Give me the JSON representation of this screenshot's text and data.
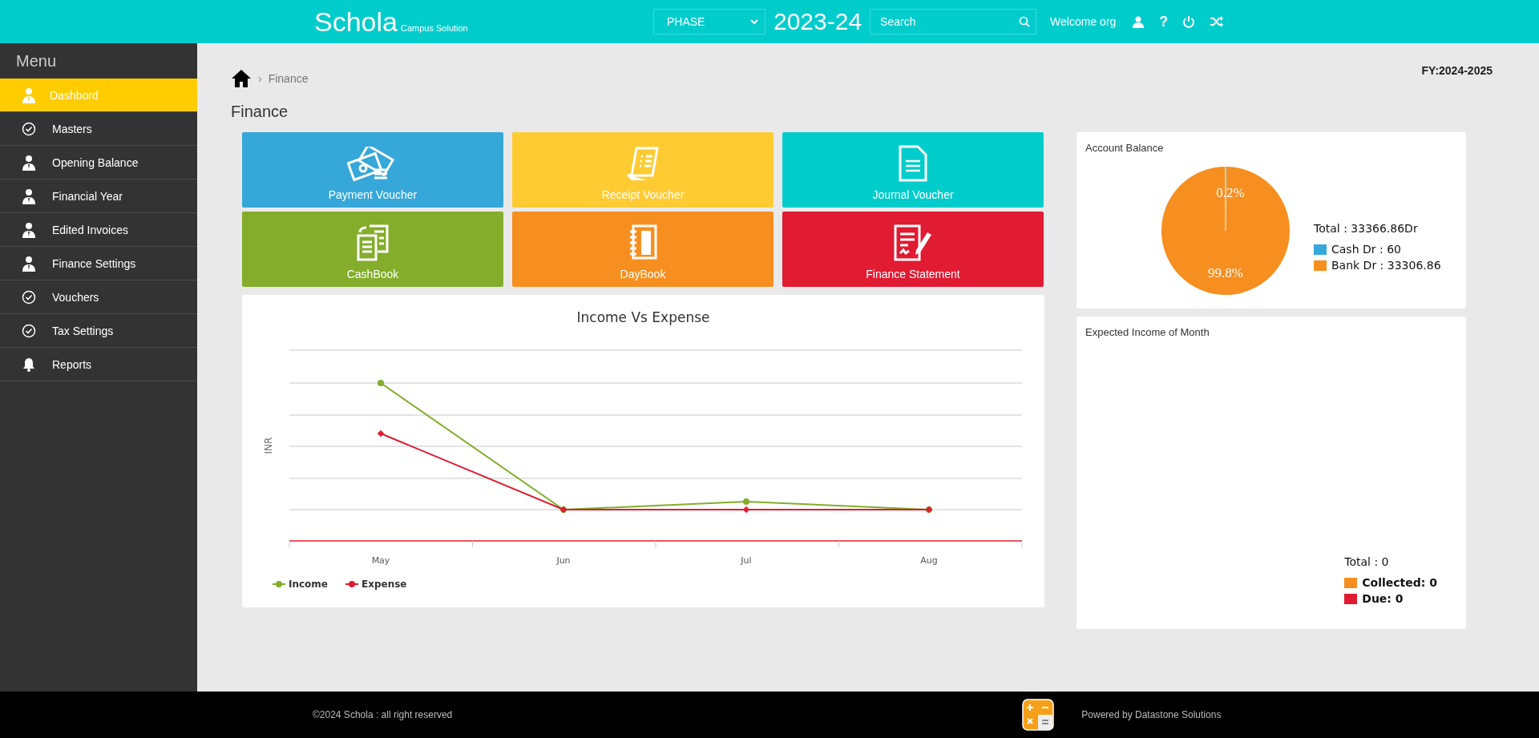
{
  "header": {
    "logo": "Schola",
    "logo_tagline": "Campus Solution",
    "phase_select": "PHASE",
    "academic_year": "2023-24",
    "search": {
      "placeholder": "Search"
    },
    "welcome": "Welcome org",
    "help_glyph": "?"
  },
  "sidebar": {
    "title": "Menu",
    "items": [
      {
        "label": "Dashbord",
        "kind": "person",
        "selected": true
      },
      {
        "label": "Masters",
        "kind": "check",
        "selected": false
      },
      {
        "label": "Opening Balance",
        "kind": "person",
        "selected": false
      },
      {
        "label": "Financial Year",
        "kind": "person",
        "selected": false
      },
      {
        "label": "Edited Invoices",
        "kind": "person",
        "selected": false
      },
      {
        "label": "Finance Settings",
        "kind": "person",
        "selected": false
      },
      {
        "label": "Vouchers",
        "kind": "check",
        "selected": false
      },
      {
        "label": "Tax Settings",
        "kind": "check",
        "selected": false
      },
      {
        "label": "Reports",
        "kind": "bell",
        "selected": false
      }
    ]
  },
  "breadcrumb": {
    "separator": "›",
    "current": "Finance"
  },
  "fiscal_year": "FY:2024-2025",
  "page_title": "Finance",
  "tiles": [
    {
      "label": "Payment Voucher",
      "kind": "money",
      "color": "#35a7d8"
    },
    {
      "label": "Receipt Voucher",
      "kind": "receipt",
      "color": "#ffcb33"
    },
    {
      "label": "Journal Voucher",
      "kind": "document",
      "color": "#00cccc"
    },
    {
      "label": "CashBook",
      "kind": "copy",
      "color": "#83ad2a"
    },
    {
      "label": "DayBook",
      "kind": "notebook",
      "color": "#f68f1f"
    },
    {
      "label": "Finance Statement",
      "kind": "statement",
      "color": "#e01b32"
    }
  ],
  "income_chart": {
    "title": "Income Vs Expense",
    "ylabel": "INR",
    "months": [
      "May",
      "Jun",
      "Jul",
      "Aug"
    ],
    "legend": [
      {
        "label": "Income",
        "color": "#83ad2a"
      },
      {
        "label": "Expense",
        "color": "#e01b32"
      }
    ]
  },
  "account_balance": {
    "title": "Account Balance",
    "chart_data": {
      "type": "pie",
      "values": [
        0.2,
        99.8
      ],
      "value_labels": [
        "0.2%",
        "99.8%"
      ]
    },
    "total": "Total : 33366.86Dr",
    "legend": [
      {
        "label": "Cash Dr : 60",
        "color": "#35a7d8"
      },
      {
        "label": "Bank Dr : 33306.86",
        "color": "#f68f1f"
      }
    ]
  },
  "expected_income": {
    "title": "Expected Income of Month",
    "total": "Total : 0",
    "legend": [
      {
        "label": "Collected: 0",
        "color": "#f68f1f"
      },
      {
        "label": "Due: 0",
        "color": "#e01b32"
      }
    ]
  },
  "footer": {
    "copyright": "©2024 Schola : all right reserved",
    "powered_by": "Powered by Datastone Solutions"
  }
}
